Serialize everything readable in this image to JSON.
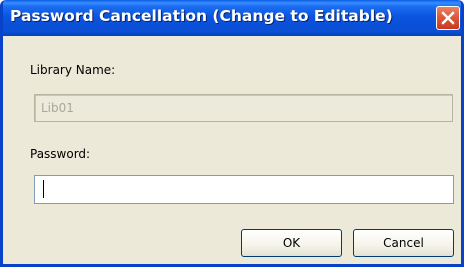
{
  "dialog": {
    "title": "Password Cancellation (Change to Editable)",
    "close_icon": "close-x-icon"
  },
  "library": {
    "label": "Library Name:",
    "value": "Lib01",
    "disabled": true
  },
  "password": {
    "label": "Password:",
    "value": ""
  },
  "buttons": {
    "ok": "OK",
    "cancel": "Cancel"
  },
  "colors": {
    "titlebar": "#0a4fd8",
    "dialog_bg": "#ece9d8",
    "close_button": "#dd5a3c"
  }
}
